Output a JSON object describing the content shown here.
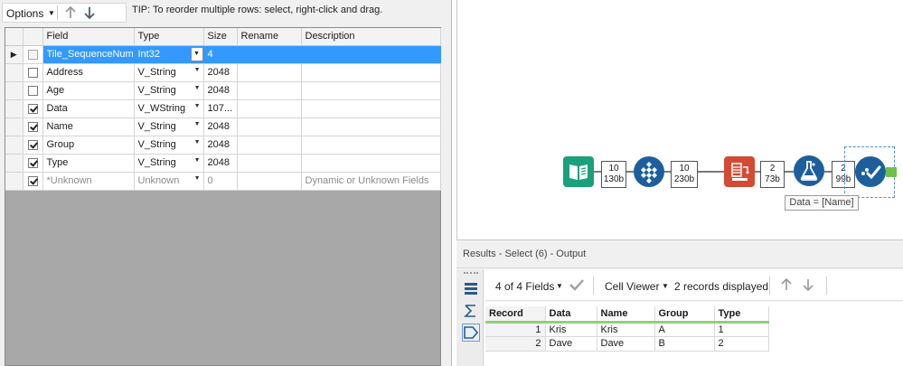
{
  "toolbar": {
    "options_label": "Options",
    "tip": "TIP: To reorder multiple rows: select, right-click and drag."
  },
  "grid": {
    "columns": {
      "field": "Field",
      "type": "Type",
      "size": "Size",
      "rename": "Rename",
      "description": "Description"
    },
    "rows": [
      {
        "checked": false,
        "field": "Tile_SequenceNum",
        "type": "Int32",
        "size": "4",
        "rename": "",
        "description": ""
      },
      {
        "checked": false,
        "field": "Address",
        "type": "V_String",
        "size": "2048",
        "rename": "",
        "description": ""
      },
      {
        "checked": false,
        "field": "Age",
        "type": "V_String",
        "size": "2048",
        "rename": "",
        "description": ""
      },
      {
        "checked": true,
        "field": "Data",
        "type": "V_WString",
        "size": "107...",
        "rename": "",
        "description": ""
      },
      {
        "checked": true,
        "field": "Name",
        "type": "V_String",
        "size": "2048",
        "rename": "",
        "description": ""
      },
      {
        "checked": true,
        "field": "Group",
        "type": "V_String",
        "size": "2048",
        "rename": "",
        "description": ""
      },
      {
        "checked": true,
        "field": "Type",
        "type": "V_String",
        "size": "2048",
        "rename": "",
        "description": ""
      },
      {
        "checked": true,
        "field": "*Unknown",
        "type": "Unknown",
        "size": "0",
        "rename": "",
        "description": "Dynamic or Unknown Fields"
      }
    ]
  },
  "canvas": {
    "stats": [
      {
        "records": "10",
        "size": "130b"
      },
      {
        "records": "10",
        "size": "230b"
      },
      {
        "records": "2",
        "size": "73b"
      },
      {
        "records": "2",
        "size": "99b"
      }
    ],
    "annotation": "Data = [Name]",
    "tool_icons": [
      "book-icon",
      "grid-diamond-icon",
      "transpose-icon",
      "formula-flask-icon",
      "select-check-icon"
    ],
    "colors": {
      "input": "#1aa07a",
      "preparation": "#1d5f9c",
      "transform": "#d44a33",
      "connector": "#6ec04a"
    }
  },
  "results": {
    "title": "Results - Select (6) - Output",
    "fields_label": "4 of 4 Fields",
    "cell_viewer_label": "Cell Viewer",
    "records_displayed": "2 records displayed",
    "columns": [
      "Record",
      "Data",
      "Name",
      "Group",
      "Type"
    ],
    "rows": [
      [
        "1",
        "Kris",
        "Kris",
        "A",
        "1"
      ],
      [
        "2",
        "Dave",
        "Dave",
        "B",
        "2"
      ]
    ]
  }
}
